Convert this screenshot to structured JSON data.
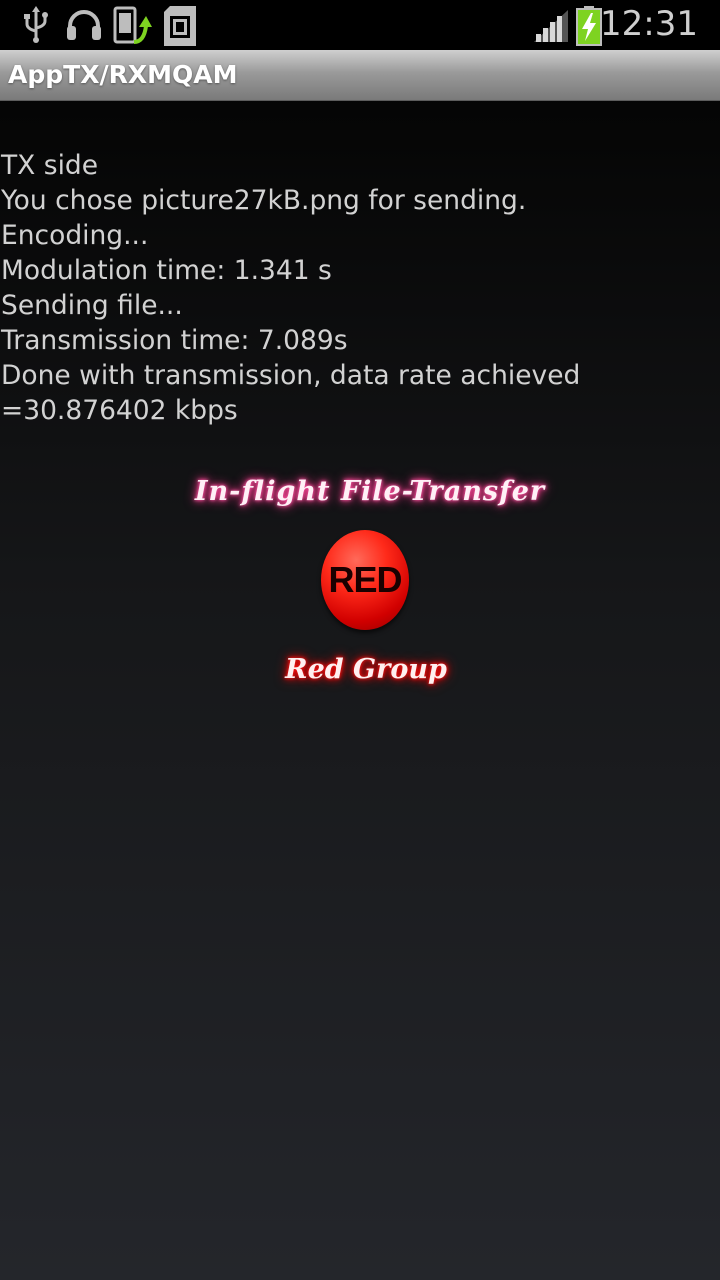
{
  "status_bar": {
    "time": "12:31",
    "icons": [
      "usb-icon",
      "headset-icon",
      "phone-update-icon",
      "sd-card-icon",
      "signal-icon",
      "battery-charging-icon"
    ]
  },
  "title_bar": {
    "title": "AppTX/RXMQAM"
  },
  "log": [
    "TX side",
    "You chose picture27kB.png for sending.",
    "Encoding...",
    "Modulation time: 1.341 s",
    "Sending file...",
    "Transmission time: 7.089s",
    "Done with transmission, data rate achieved",
    "=30.876402 kbps"
  ],
  "branding": {
    "app_title": "In-flight File-Transfer",
    "logo_text": "RED",
    "group_name": "Red Group"
  },
  "colors": {
    "log_text": "#d2d2d2",
    "title_bar_text": "#ffffff",
    "logo_red": "#e00000",
    "glow_pink": "#ff3c8f",
    "glow_red": "#ff0000",
    "battery_green": "#7ed321"
  }
}
